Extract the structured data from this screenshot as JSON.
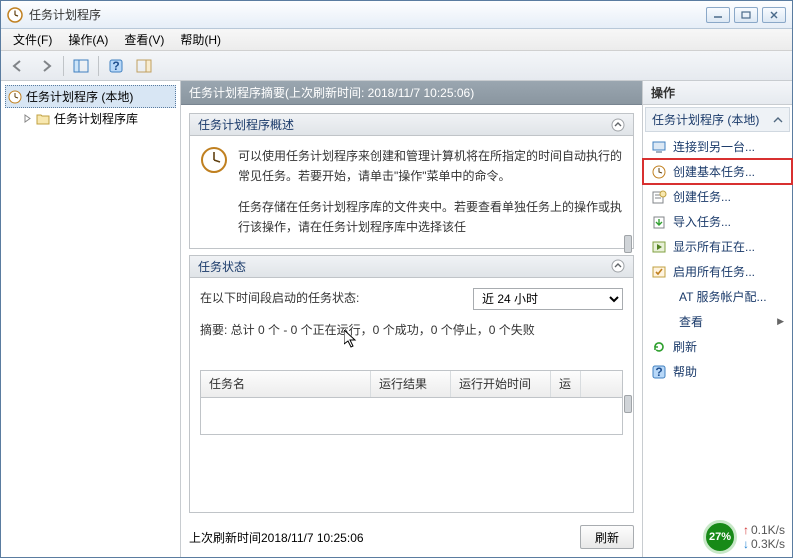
{
  "window": {
    "title": "任务计划程序"
  },
  "menu": {
    "file": "文件(F)",
    "action": "操作(A)",
    "view": "查看(V)",
    "help": "帮助(H)"
  },
  "tree": {
    "root": "任务计划程序 (本地)",
    "library": "任务计划程序库"
  },
  "summary_header": "任务计划程序摘要(上次刷新时间: 2018/11/7 10:25:06)",
  "overview": {
    "title": "任务计划程序概述",
    "text1": "可以使用任务计划程序来创建和管理计算机将在所指定的时间自动执行的常见任务。若要开始，请单击\"操作\"菜单中的命令。",
    "text2": "任务存储在任务计划程序库的文件夹中。若要查看单独任务上的操作或执行该操作，请在任务计划程序库中选择该任"
  },
  "status": {
    "title": "任务状态",
    "label": "在以下时间段启动的任务状态:",
    "combo_value": "近 24 小时",
    "summary": "摘要: 总计 0 个 - 0 个正在运行，0 个成功，0 个停止，0 个失败"
  },
  "table": {
    "cols": {
      "name": "任务名",
      "result": "运行结果",
      "start": "运行开始时间",
      "more": "运"
    }
  },
  "footer": {
    "last_refresh": "上次刷新时间2018/11/7 10:25:06",
    "refresh_btn": "刷新"
  },
  "actions": {
    "header": "操作",
    "group": "任务计划程序 (本地)",
    "items": {
      "connect": "连接到另一台...",
      "create_basic": "创建基本任务...",
      "create": "创建任务...",
      "import": "导入任务...",
      "show_running": "显示所有正在...",
      "enable_all": "启用所有任务...",
      "at_account": "AT 服务帐户配...",
      "view": "查看",
      "refresh": "刷新",
      "help": "帮助"
    }
  },
  "netmon": {
    "pct": "27%",
    "up": "0.1K/s",
    "down": "0.3K/s"
  }
}
